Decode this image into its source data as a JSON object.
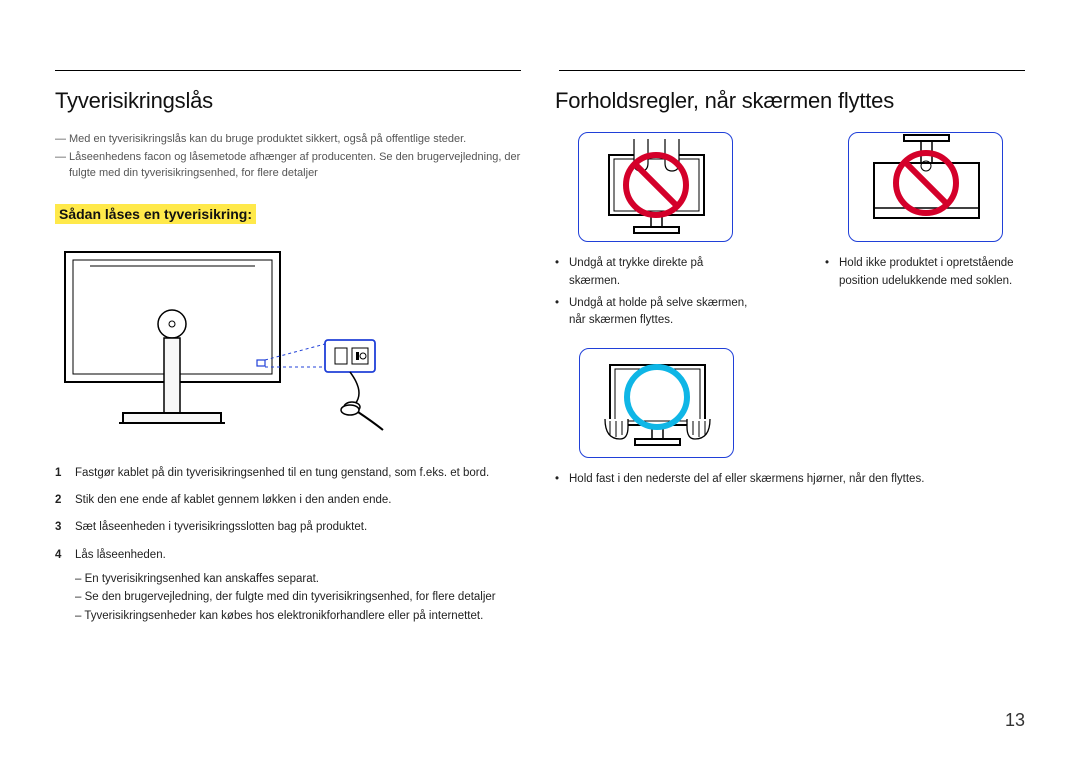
{
  "left": {
    "heading": "Tyverisikringslås",
    "note1": "Med en tyverisikringslås kan du bruge produktet sikkert, også på offentlige steder.",
    "note2": "Låseenhedens facon og låsemetode afhænger af producenten. Se den brugervejledning, der fulgte med din tyverisikringsenhed, for flere detaljer",
    "subheading": "Sådan låses en tyverisikring:",
    "step1": "Fastgør kablet på din tyverisikringsenhed til en tung genstand, som f.eks. et bord.",
    "step2": "Stik den ene ende af kablet gennem løkken i den anden ende.",
    "step3": "Sæt låseenheden i tyverisikringsslotten bag på produktet.",
    "step4": "Lås låseenheden.",
    "step4_sub1": "En tyverisikringsenhed kan anskaffes separat.",
    "step4_sub2": "Se den brugervejledning, der fulgte med din tyverisikringsenhed, for flere detaljer",
    "step4_sub3": "Tyverisikringsenheder kan købes hos elektronikforhandlere eller på internettet."
  },
  "right": {
    "heading": "Forholdsregler, når skærmen flyttes",
    "col1_b1": "Undgå at trykke direkte på skærmen.",
    "col1_b2": "Undgå at holde på selve skærmen, når skærmen flyttes.",
    "col2_b1": "Hold ikke produktet i opretstående position udelukkende med soklen.",
    "col1_bottom_b1": "Hold fast i den nederste del af eller skærmens hjørner, når den flyttes."
  },
  "page_number": "13"
}
